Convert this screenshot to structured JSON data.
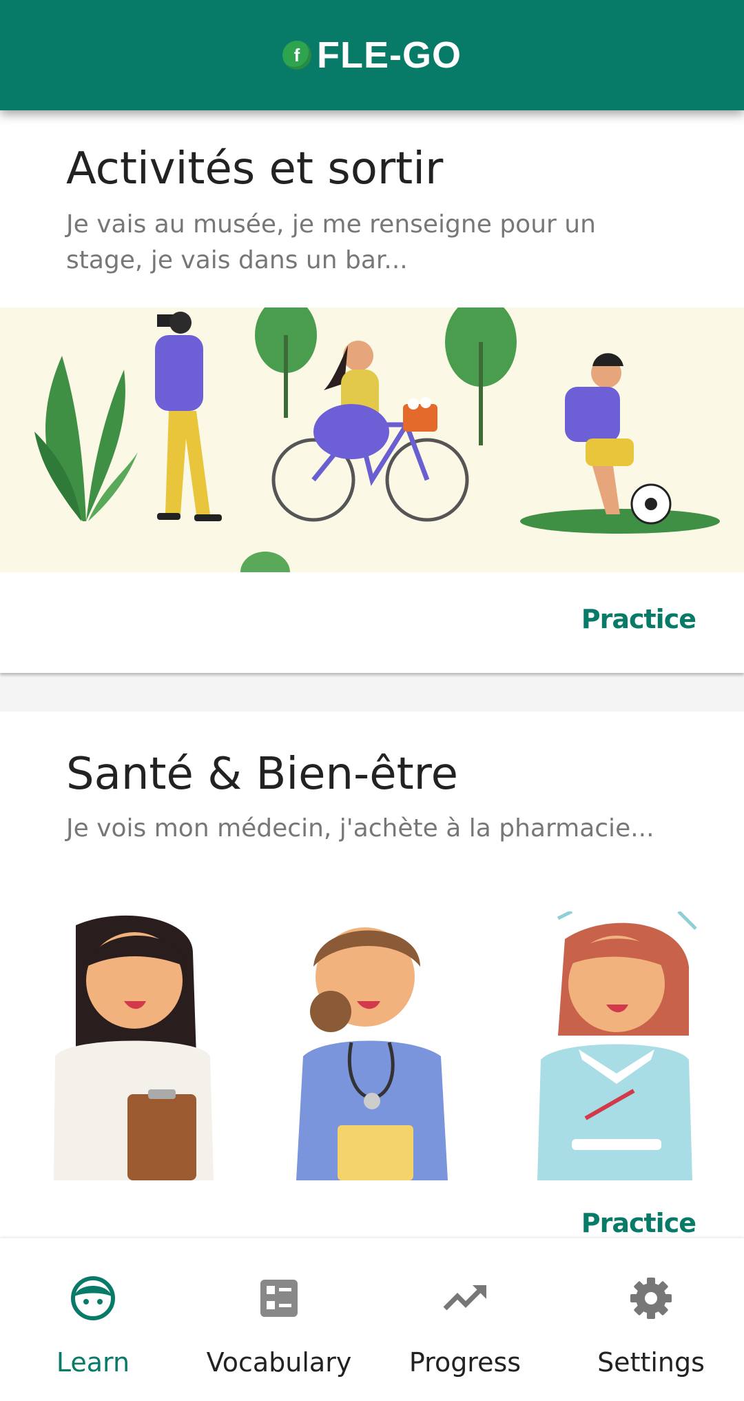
{
  "app": {
    "title": "FLE-GO",
    "logo_letter": "f"
  },
  "cards": [
    {
      "title": "Activités et sortir",
      "description": "Je vais au musée, je me renseigne pour un stage, je vais dans un bar...",
      "action_label": "Practice",
      "image": "activities-illustration"
    },
    {
      "title": "Santé & Bien-être",
      "description": "Je vois mon médecin, j'achète à la pharmacie...",
      "action_label": "Practice",
      "image": "health-workers-illustration"
    }
  ],
  "nav": [
    {
      "label": "Learn",
      "icon": "face-icon",
      "active": true
    },
    {
      "label": "Vocabulary",
      "icon": "list-icon",
      "active": false
    },
    {
      "label": "Progress",
      "icon": "trending-up-icon",
      "active": false
    },
    {
      "label": "Settings",
      "icon": "gear-icon",
      "active": false
    }
  ],
  "colors": {
    "primary": "#087a68",
    "logo_green": "#2ea44f",
    "image_bg": "#fbf9e6"
  }
}
